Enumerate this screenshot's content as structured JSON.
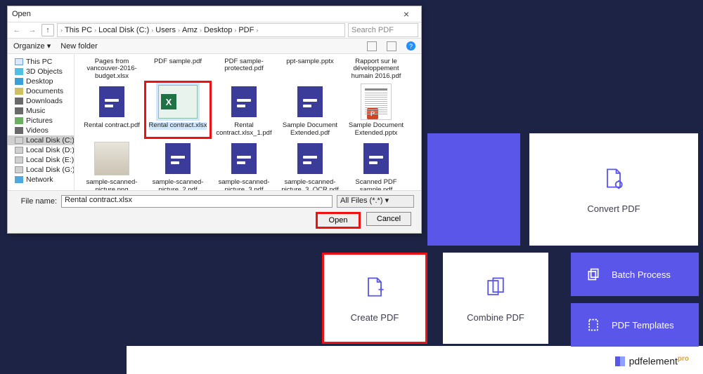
{
  "dialog": {
    "title": "Open",
    "breadcrumb": [
      "This PC",
      "Local Disk (C:)",
      "Users",
      "Amz",
      "Desktop",
      "PDF"
    ],
    "search_placeholder": "Search PDF",
    "organize": "Organize",
    "new_folder": "New folder",
    "tree": [
      {
        "label": "This PC",
        "icon": "ico-pc"
      },
      {
        "label": "3D Objects",
        "icon": "ico-3d"
      },
      {
        "label": "Desktop",
        "icon": "ico-desk"
      },
      {
        "label": "Documents",
        "icon": "ico-doc"
      },
      {
        "label": "Downloads",
        "icon": "ico-dl"
      },
      {
        "label": "Music",
        "icon": "ico-mus"
      },
      {
        "label": "Pictures",
        "icon": "ico-pic"
      },
      {
        "label": "Videos",
        "icon": "ico-vid"
      },
      {
        "label": "Local Disk (C:)",
        "icon": "ico-disk",
        "selected": true
      },
      {
        "label": "Local Disk (D:)",
        "icon": "ico-disk"
      },
      {
        "label": "Local Disk (E:)",
        "icon": "ico-disk"
      },
      {
        "label": "Local Disk (G:)",
        "icon": "ico-disk"
      },
      {
        "label": "Network",
        "icon": "ico-net"
      }
    ],
    "files_row1": [
      {
        "label": "Pages from vancouver-2016-budget.xlsx",
        "thumb": "none"
      },
      {
        "label": "PDF sample.pdf",
        "thumb": "none"
      },
      {
        "label": "PDF sample-protected.pdf",
        "thumb": "none"
      },
      {
        "label": "ppt-sample.pptx",
        "thumb": "none"
      },
      {
        "label": "Rapport sur le développement humain 2016.pdf",
        "thumb": "none"
      }
    ],
    "files_row2": [
      {
        "label": "Rental contract.pdf",
        "thumb": "pdf"
      },
      {
        "label": "Rental contract.xlsx",
        "thumb": "xlsx",
        "selected": true
      },
      {
        "label": "Rental contract.xlsx_1.pdf",
        "thumb": "pdf"
      },
      {
        "label": "Sample Document Extended.pdf",
        "thumb": "pdf"
      },
      {
        "label": "Sample Document Extended.pptx",
        "thumb": "doc",
        "pp": true
      }
    ],
    "files_row3": [
      {
        "label": "sample-scanned-picture.png",
        "thumb": "scan"
      },
      {
        "label": "sample-scanned-picture_2.pdf",
        "thumb": "pdf"
      },
      {
        "label": "sample-scanned-picture_3.pdf",
        "thumb": "pdf"
      },
      {
        "label": "sample-scanned-picture_3_OCR.pdf",
        "thumb": "pdf"
      },
      {
        "label": "Scanned PDF sample.pdf",
        "thumb": "pdf"
      }
    ],
    "filename_label": "File name:",
    "filename_value": "Rental contract.xlsx",
    "filetype": "All Files (*.*)",
    "open_btn": "Open",
    "cancel_btn": "Cancel"
  },
  "app": {
    "convert": "Convert PDF",
    "create": "Create PDF",
    "combine": "Combine PDF",
    "batch": "Batch Process",
    "templates": "PDF Templates",
    "brand": "pdfelement",
    "brand_suffix": "pro"
  }
}
